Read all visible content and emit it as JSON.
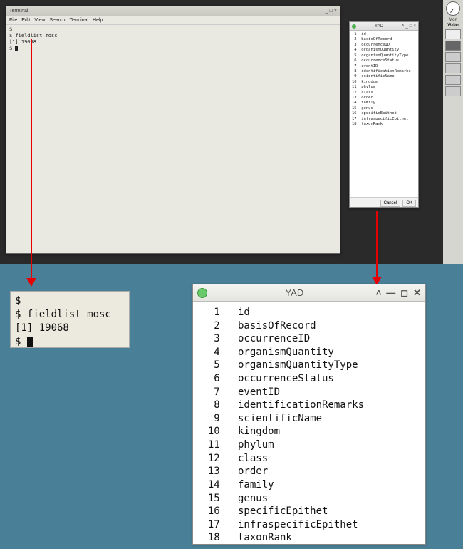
{
  "desktop": {
    "terminal": {
      "title": "Terminal",
      "menu": [
        "File",
        "Edit",
        "View",
        "Search",
        "Terminal",
        "Help"
      ],
      "lines": {
        "l1": "$",
        "l2": "$ fieldlist mosc",
        "l3": "[1] 19068",
        "l4": "$ "
      }
    },
    "yad": {
      "title": "YAD",
      "buttons": {
        "cancel": "Cancel",
        "ok": "OK"
      }
    },
    "panel": {
      "day": "Mon",
      "date": "05 Oct"
    }
  },
  "fields": [
    {
      "n": 1,
      "name": "id"
    },
    {
      "n": 2,
      "name": "basisOfRecord"
    },
    {
      "n": 3,
      "name": "occurrenceID"
    },
    {
      "n": 4,
      "name": "organismQuantity"
    },
    {
      "n": 5,
      "name": "organismQuantityType"
    },
    {
      "n": 6,
      "name": "occurrenceStatus"
    },
    {
      "n": 7,
      "name": "eventID"
    },
    {
      "n": 8,
      "name": "identificationRemarks"
    },
    {
      "n": 9,
      "name": "scientificName"
    },
    {
      "n": 10,
      "name": "kingdom"
    },
    {
      "n": 11,
      "name": "phylum"
    },
    {
      "n": 12,
      "name": "class"
    },
    {
      "n": 13,
      "name": "order"
    },
    {
      "n": 14,
      "name": "family"
    },
    {
      "n": 15,
      "name": "genus"
    },
    {
      "n": 16,
      "name": "specificEpithet"
    },
    {
      "n": 17,
      "name": "infraspecificEpithet"
    },
    {
      "n": 18,
      "name": "taxonRank"
    }
  ],
  "zoom_term": {
    "l1": "$",
    "l2": "$ fieldlist mosc",
    "l3": "[1] 19068",
    "l4": "$ "
  },
  "zoom_yad": {
    "title": "YAD"
  }
}
